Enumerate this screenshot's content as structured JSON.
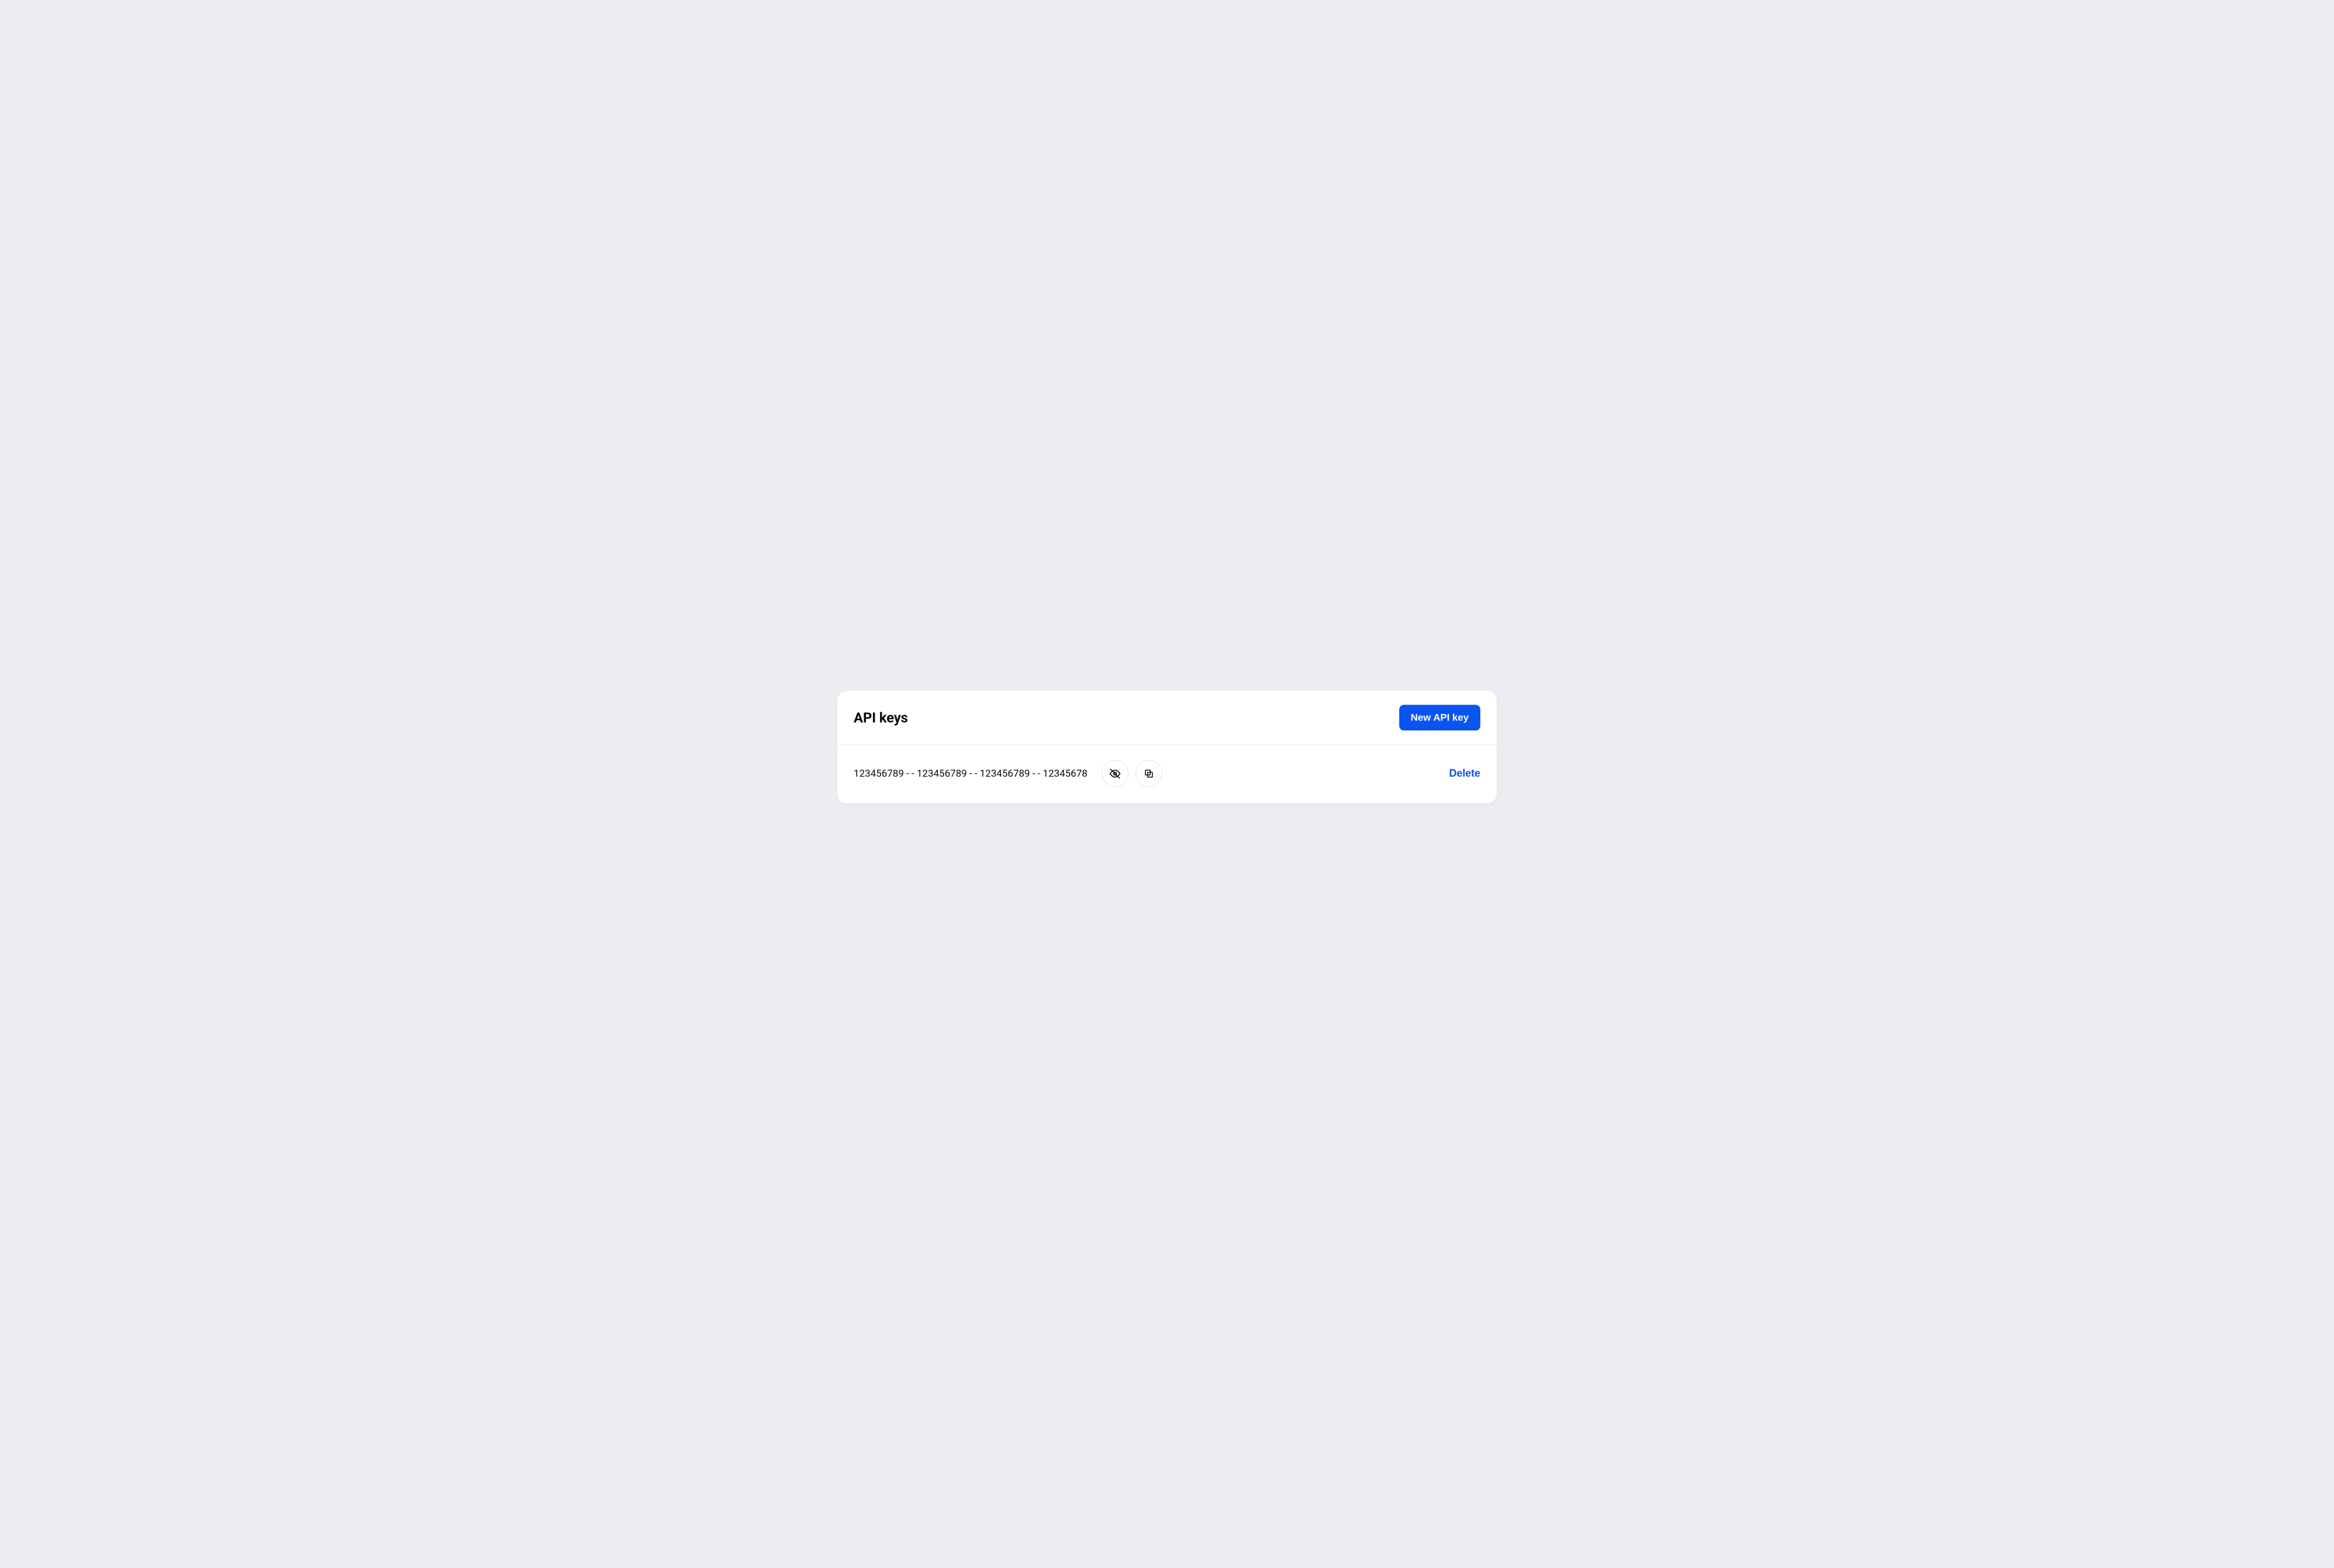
{
  "card": {
    "title": "API keys",
    "new_button_label": "New API key"
  },
  "keys": [
    {
      "value": "123456789 - - 123456789 - - 123456789 - - 12345678",
      "delete_label": "Delete"
    }
  ],
  "icons": {
    "visibility_off": "visibility-off-icon",
    "copy": "copy-icon"
  },
  "colors": {
    "primary": "#0a54f2",
    "background": "#eceef2",
    "surface": "#ffffff",
    "text": "#0b0b0d",
    "border": "#e4e6ec"
  }
}
